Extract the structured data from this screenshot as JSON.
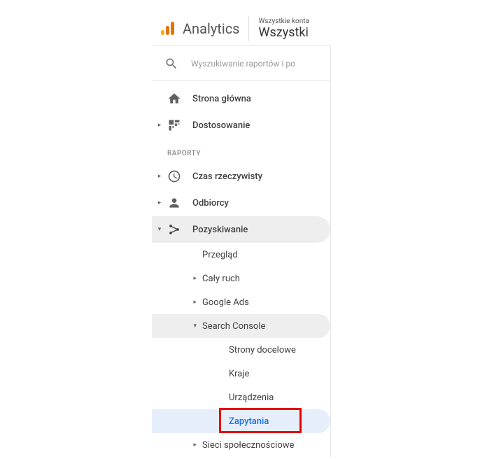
{
  "header": {
    "brand": "Analytics",
    "account_top": "Wszystkie konta",
    "account_bottom": "Wszystki"
  },
  "search": {
    "placeholder": "Wyszukiwanie raportów i po"
  },
  "nav": {
    "home": "Strona główna",
    "customize": "Dostosowanie",
    "reports_header": "RAPORTY",
    "realtime": "Czas rzeczywisty",
    "audience": "Odbiorcy",
    "acquisition": "Pozyskiwanie",
    "sub": {
      "overview": "Przegląd",
      "all_traffic": "Cały ruch",
      "google_ads": "Google Ads",
      "search_console": "Search Console",
      "sc_landing": "Strony docelowe",
      "sc_countries": "Kraje",
      "sc_devices": "Urządzenia",
      "sc_queries": "Zapytania",
      "social": "Sieci społecznościowe"
    }
  }
}
